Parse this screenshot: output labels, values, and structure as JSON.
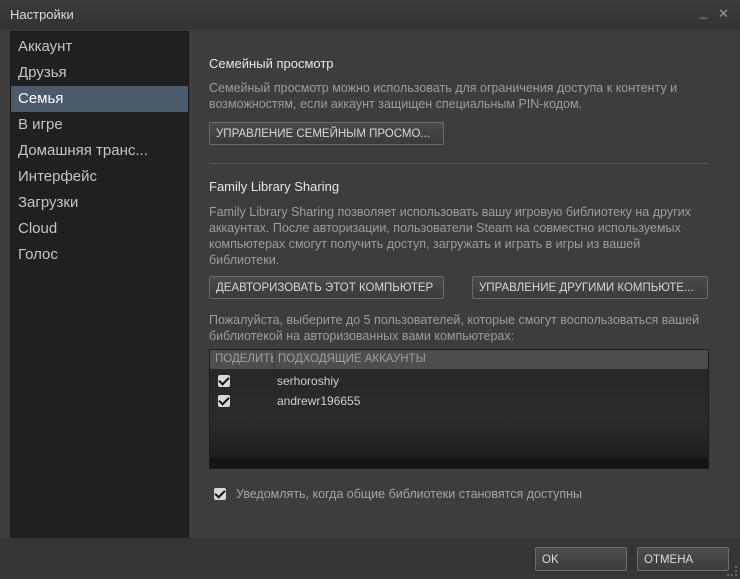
{
  "window": {
    "title": "Настройки",
    "minimize_glyph": "_",
    "close_glyph": "✕"
  },
  "sidebar": {
    "items": [
      {
        "label": "Аккаунт"
      },
      {
        "label": "Друзья"
      },
      {
        "label": "Семья",
        "active": true
      },
      {
        "label": "В игре"
      },
      {
        "label": "Домашняя транс..."
      },
      {
        "label": "Интерфейс"
      },
      {
        "label": "Загрузки"
      },
      {
        "label": "Cloud"
      },
      {
        "label": "Голос"
      }
    ]
  },
  "family_view": {
    "title": "Семейный просмотр",
    "description": "Семейный просмотр можно использовать для ограничения доступа к контенту и возможностям, если аккаунт защищен специальным PIN-кодом.",
    "manage_button": "УПРАВЛЕНИЕ СЕМЕЙНЫМ ПРОСМО..."
  },
  "library_sharing": {
    "title": "Family Library Sharing",
    "description": "Family Library Sharing позволяет использовать вашу игровую библиотеку на других аккаунтах. После авторизации, пользователи Steam на совместно используемых компьютерах смогут получить доступ, загружать и играть в игры из вашей библиотеки.",
    "deauthorize_button": "ДЕАВТОРИЗОВАТЬ ЭТОТ КОМПЬЮТЕР",
    "manage_computers_button": "УПРАВЛЕНИЕ ДРУГИМИ КОМПЬЮТЕ...",
    "select_hint": "Пожалуйста, выберите до 5 пользователей, которые смогут воспользоваться вашей библиотекой на авторизованных вами компьютерах:",
    "table": {
      "col_share": "ПОДЕЛИТЬСЯ",
      "col_accounts": "ПОДХОДЯЩИЕ АККАУНТЫ",
      "rows": [
        {
          "checked": true,
          "account": "serhoroshiy"
        },
        {
          "checked": true,
          "account": "andrewr196655"
        }
      ]
    },
    "notify_checked": true,
    "notify_label": "Уведомлять, когда общие библиотеки становятся доступны"
  },
  "footer": {
    "ok": "OK",
    "cancel": "ОТМЕНА"
  },
  "colors": {
    "background": "#3d3d3d",
    "sidebar": "#202020",
    "active_item": "#4c5a6d"
  }
}
